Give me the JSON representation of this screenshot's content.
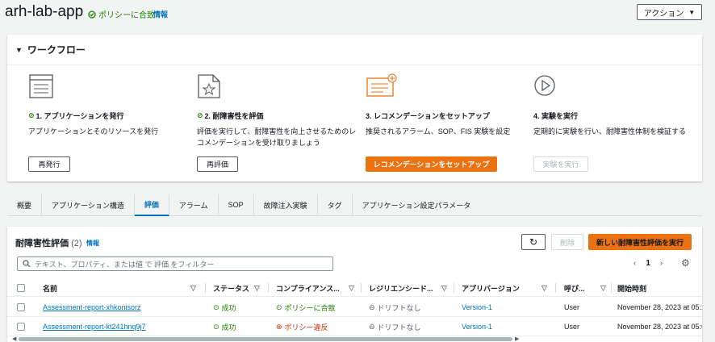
{
  "header": {
    "app_title": "arh-lab-app",
    "compliance": "ポリシーに合致",
    "info": "情報",
    "actions": "アクション"
  },
  "workflow": {
    "title": "ワークフロー",
    "steps": [
      {
        "icon": "list-document-icon",
        "title": "1. アプリケーションを発行",
        "desc": "アプリケーションとそのリソースを発行",
        "button": "再発行",
        "done": true
      },
      {
        "icon": "document-star-icon",
        "title": "2. 耐障害性を評価",
        "desc": "評価を実行して、耐障害性を向上させるためのレコメンデーションを受け取りましょう",
        "button": "再評価",
        "done": true
      },
      {
        "icon": "recommendation-card-icon",
        "title": "3. レコメンデーションをセットアップ",
        "desc": "推奨されるアラーム、SOP、FIS 実験を設定",
        "button": "レコメンデーションをセットアップ",
        "done": false
      },
      {
        "icon": "play-circle-icon",
        "title": "4. 実験を実行",
        "desc": "定期的に実験を行い、耐障害性体制を検証する",
        "button": "実験を実行",
        "done": false
      }
    ]
  },
  "tabs": [
    "概要",
    "アプリケーション構造",
    "評価",
    "アラーム",
    "SOP",
    "故障注入実験",
    "タグ",
    "アプリケーション設定パラメータ"
  ],
  "active_tab": "評価",
  "assessments": {
    "title": "耐障害性評価",
    "count": "(2)",
    "info": "情報",
    "delete": "削除",
    "new": "新しい耐障害性評価を実行",
    "filter_placeholder": "テキスト、プロパティ、または値 で 評価 をフィルター",
    "page": "1",
    "columns": [
      "名前",
      "ステータス",
      "コンプライアンス...",
      "レジリエンシード...",
      "アプリバージョン",
      "呼び...",
      "開始時刻"
    ],
    "rows": [
      {
        "name": "Assessment-report-xhkonisorz",
        "status": "成功",
        "compliance": "ポリシーに合致",
        "compliance_ok": true,
        "drift": "ドリフトなし",
        "version": "Version-1",
        "invoker": "User",
        "start": "November 28, 2023 at 05:2"
      },
      {
        "name": "Assessment-report-kt241hnq9j7",
        "status": "成功",
        "compliance": "ポリシー違反",
        "compliance_ok": false,
        "drift": "ドリフトなし",
        "version": "Version-1",
        "invoker": "User",
        "start": "November 28, 2023 at 05:0"
      }
    ]
  },
  "colors": {
    "accent": "#0073bb",
    "success": "#1d8102",
    "error": "#d13212",
    "primary_button": "#ec7211"
  }
}
